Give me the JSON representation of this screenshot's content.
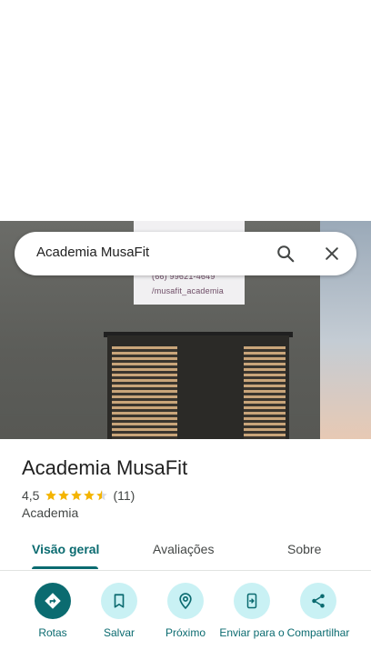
{
  "search": {
    "query": "Academia MusaFit",
    "search_icon": "search-icon",
    "close_icon": "close-icon"
  },
  "photo": {
    "sign_phone": "(66) 99621-4649",
    "sign_handle": "/musafit_academia"
  },
  "place": {
    "name": "Academia MusaFit",
    "rating": "4,5",
    "rating_value": 4.5,
    "reviews_count": "(11)",
    "category": "Academia"
  },
  "tabs": [
    {
      "label": "Visão geral",
      "active": true
    },
    {
      "label": "Avaliações",
      "active": false
    },
    {
      "label": "Sobre",
      "active": false
    }
  ],
  "actions": [
    {
      "label": "Rotas",
      "icon": "directions-icon"
    },
    {
      "label": "Salvar",
      "icon": "bookmark-icon"
    },
    {
      "label": "Próximo",
      "icon": "nearby-icon"
    },
    {
      "label": "Enviar para o",
      "icon": "send-to-phone-icon"
    },
    {
      "label": "Compartilhar",
      "icon": "share-icon"
    }
  ],
  "colors": {
    "accent": "#0b6b70",
    "accent_light": "#c9f1f4",
    "star": "#f4b400"
  }
}
